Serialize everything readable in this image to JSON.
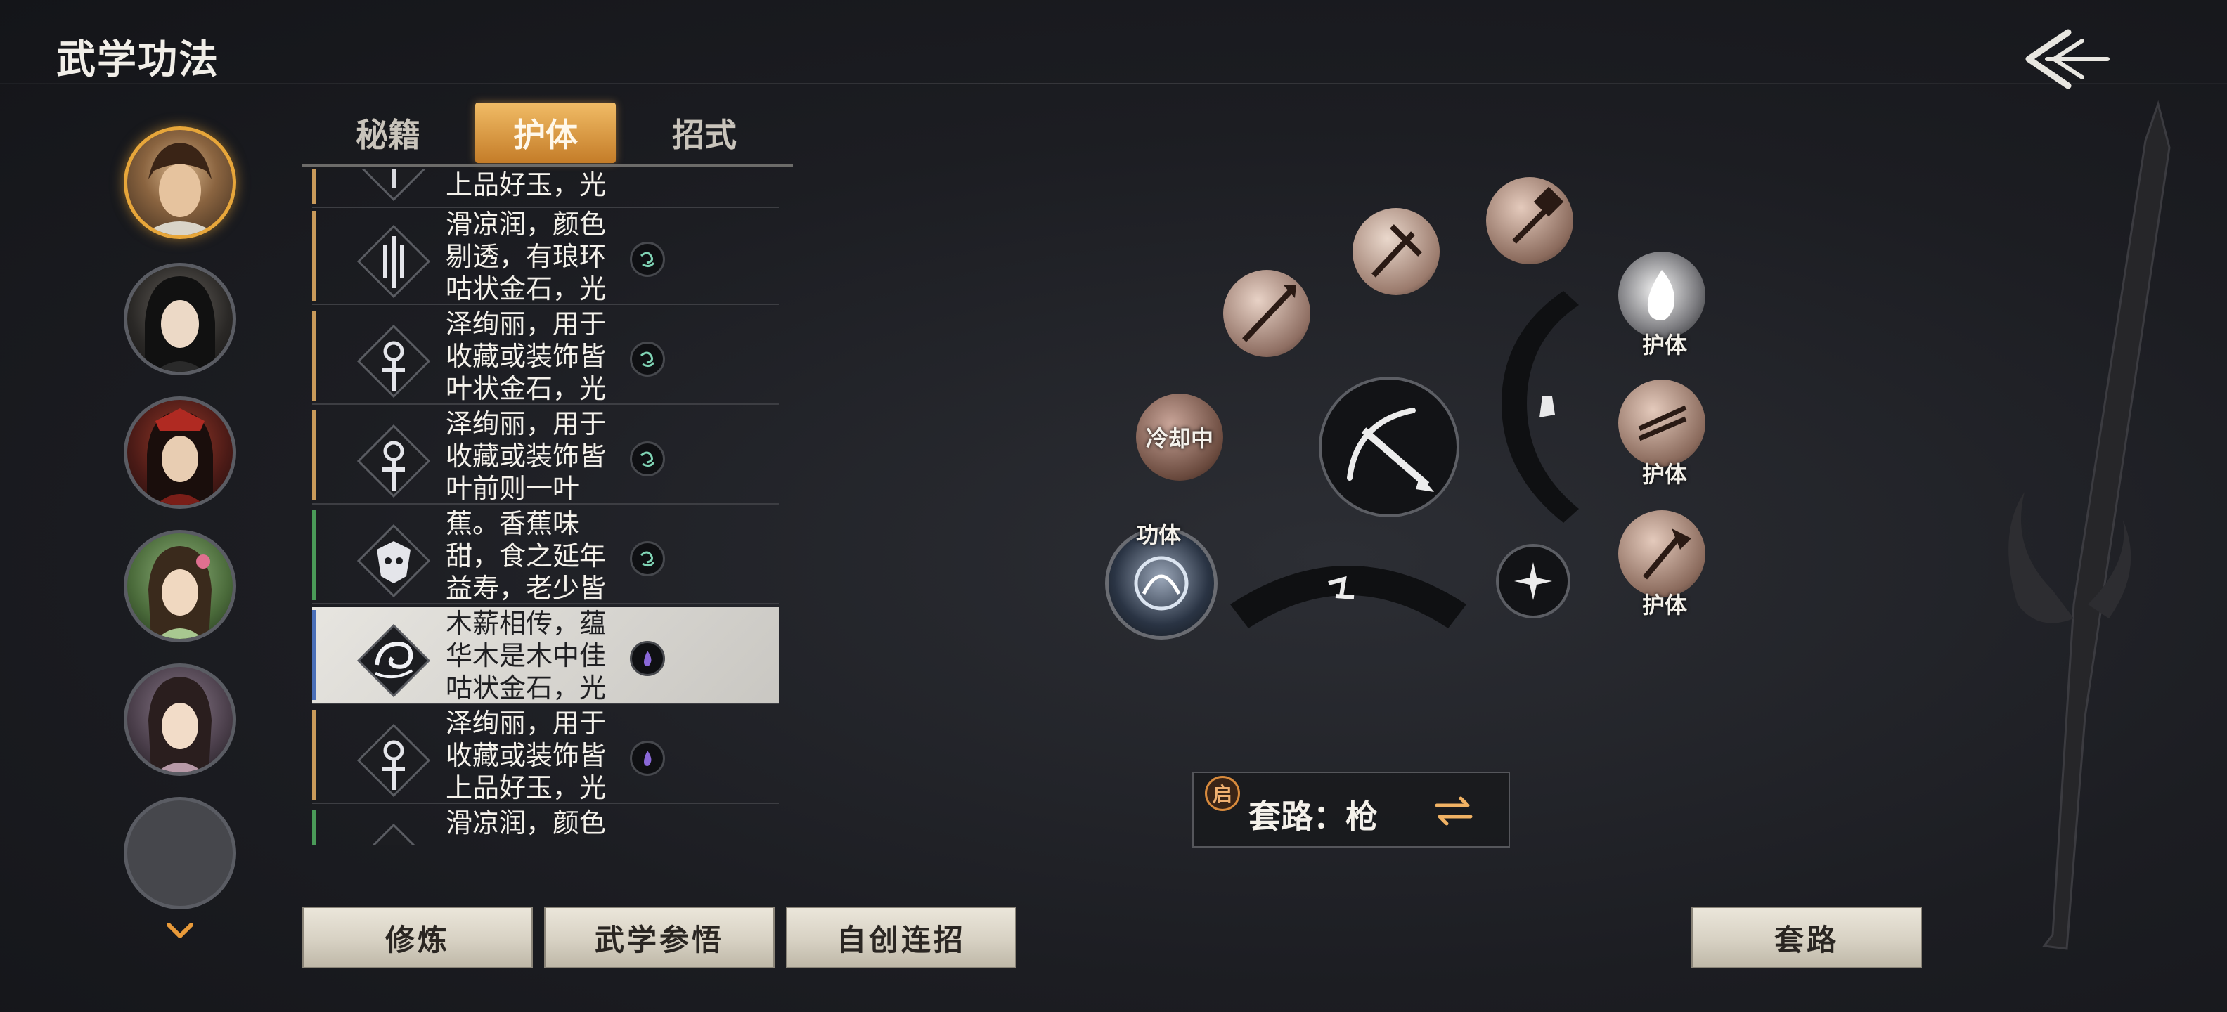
{
  "header": {
    "title": "武学功法"
  },
  "tabs": [
    {
      "label": "秘籍",
      "active": false
    },
    {
      "label": "护体",
      "active": true
    },
    {
      "label": "招式",
      "active": false
    }
  ],
  "skills": [
    {
      "desc": "上品好玉，光",
      "bar_color": "#c99a5a",
      "element": "wind"
    },
    {
      "desc": "滑凉润，颜色\n剔透，有琅环\n咕状金石，光",
      "bar_color": "#c99a5a",
      "element": "wind"
    },
    {
      "desc": "泽绚丽，用于\n收藏或装饰皆\n叶状金石，光",
      "bar_color": "#c99a5a",
      "element": "wind"
    },
    {
      "desc": "泽绚丽，用于\n收藏或装饰皆\n叶前则一叶",
      "bar_color": "#c99a5a",
      "element": "wind"
    },
    {
      "desc": "蕉。香蕉味\n甜，食之延年\n益寿，老少皆",
      "bar_color": "#4a9a58",
      "element": "wind"
    },
    {
      "desc": "木薪相传，蕴\n华木是木中佳\n咕状金石，光",
      "bar_color": "#4a6fb8",
      "element": "fire",
      "selected": true
    },
    {
      "desc": "泽绚丽，用于\n收藏或装饰皆\n上品好玉，光",
      "bar_color": "#c99a5a",
      "element": "fire"
    },
    {
      "desc": "滑凉润，颜色",
      "bar_color": "#4a9a58",
      "element": "wind"
    }
  ],
  "wheel": {
    "cooldown_label": "冷却中",
    "gongti_label": "功体",
    "huti_labels": [
      "护体",
      "护体",
      "护体"
    ]
  },
  "routine": {
    "badge": "启",
    "text": "套路：枪"
  },
  "buttons": {
    "practice": "修炼",
    "comprehend": "武学参悟",
    "custom_combo": "自创连招",
    "routine": "套路"
  },
  "colors": {
    "accent": "#e7a63a",
    "tab_active": "#d9953f"
  },
  "icons": {
    "back": "back-arrow-icon",
    "more": "chevron-down-icon",
    "swap": "swap-arrows-icon"
  }
}
